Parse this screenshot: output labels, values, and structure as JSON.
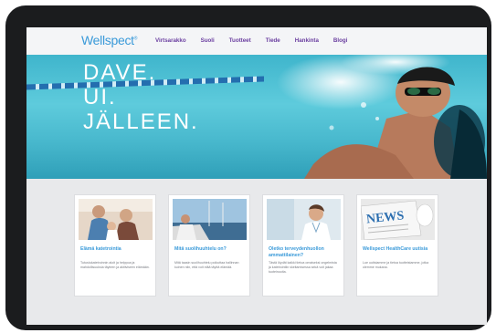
{
  "site": {
    "logo": "Wellspect",
    "logo_mark": "®"
  },
  "nav": {
    "items": [
      {
        "label": "Virtsarakko"
      },
      {
        "label": "Suoli"
      },
      {
        "label": "Tuotteet"
      },
      {
        "label": "Tiede"
      },
      {
        "label": "Hankinta"
      },
      {
        "label": "Blogi"
      }
    ]
  },
  "hero": {
    "lines": [
      "DAVE.",
      "UI.",
      "JÄLLEEN."
    ]
  },
  "cards": [
    {
      "title": "Elämä katetrointia",
      "text": "Tutustukatetroinnin aloit ja helppoa ja mahdollisuuksia täyteen ja aktiiviseen elämään.",
      "image": "family-photo"
    },
    {
      "title": "Mitä suolihuuhtelu on?",
      "text": "Mitä taasin suolihuuhtelu poikuttaa hallinnan kuinen niin, että voit elää täyttä elämää.",
      "image": "sailing-photo"
    },
    {
      "title": "Oletko terveydenhuollon ammattilainen?",
      "text": "Tästä löydät kaikki tietoa omaiseksi ongelmista ja katetrointiin skeitamisessa sekä voit jakaa tuoteinooita.",
      "image": "nurse-photo"
    },
    {
      "title": "Wellspect HealthCare uutisia",
      "text": "Lue uutisiamme ja tietoa tuotteistamme, jotka olemme mukana.",
      "image": "news-photo"
    }
  ],
  "colors": {
    "accent_blue": "#3a9ad9",
    "nav_purple": "#6b3fa0",
    "bezel": "#1b1c1e",
    "page_bg": "#e8e9eb"
  }
}
